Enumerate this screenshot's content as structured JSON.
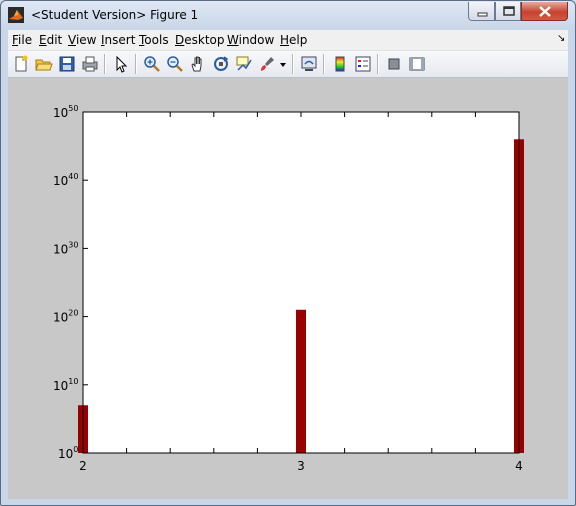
{
  "window": {
    "title": "<Student Version> Figure 1",
    "buttons": [
      "minimize-icon",
      "maximize-icon",
      "close-icon"
    ]
  },
  "menubar": {
    "items": [
      {
        "label": "File",
        "mnemonic": "F",
        "rest": "ile"
      },
      {
        "label": "Edit",
        "mnemonic": "E",
        "rest": "dit"
      },
      {
        "label": "View",
        "mnemonic": "V",
        "rest": "iew"
      },
      {
        "label": "Insert",
        "mnemonic": "I",
        "rest": "nsert"
      },
      {
        "label": "Tools",
        "mnemonic": "T",
        "rest": "ools"
      },
      {
        "label": "Desktop",
        "mnemonic": "D",
        "rest": "esktop"
      },
      {
        "label": "Window",
        "mnemonic": "W",
        "rest": "indow"
      },
      {
        "label": "Help",
        "mnemonic": "H",
        "rest": "elp"
      }
    ]
  },
  "toolbar": {
    "icons": [
      "new-figure-icon",
      "open-file-icon",
      "save-icon",
      "print-icon",
      "edit-plot-arrow-icon",
      "zoom-in-icon",
      "zoom-out-icon",
      "pan-hand-icon",
      "rotate-3d-icon",
      "data-cursor-icon",
      "brush-icon",
      "brush-dropdown-icon",
      "link-plot-icon",
      "colorbar-icon",
      "legend-icon",
      "hide-plot-tools-icon",
      "show-plot-tools-icon"
    ]
  },
  "colors": {
    "bar": "#990000",
    "figure_bg": "#c8c8c8",
    "axes_bg": "#ffffff"
  },
  "chart_data": {
    "type": "bar",
    "categories": [
      "2",
      "3",
      "4"
    ],
    "values": [
      10000000.0,
      1e+21,
      1e+46
    ],
    "yscale": "log",
    "ylim": [
      1,
      1e+50
    ],
    "xlim": [
      2,
      4
    ],
    "yticks": [
      {
        "base": "10",
        "exp": "0"
      },
      {
        "base": "10",
        "exp": "10"
      },
      {
        "base": "10",
        "exp": "20"
      },
      {
        "base": "10",
        "exp": "30"
      },
      {
        "base": "10",
        "exp": "40"
      },
      {
        "base": "10",
        "exp": "50"
      }
    ],
    "xticks": [
      "2",
      "3",
      "4"
    ],
    "grid": false,
    "title": "",
    "xlabel": "",
    "ylabel": ""
  }
}
